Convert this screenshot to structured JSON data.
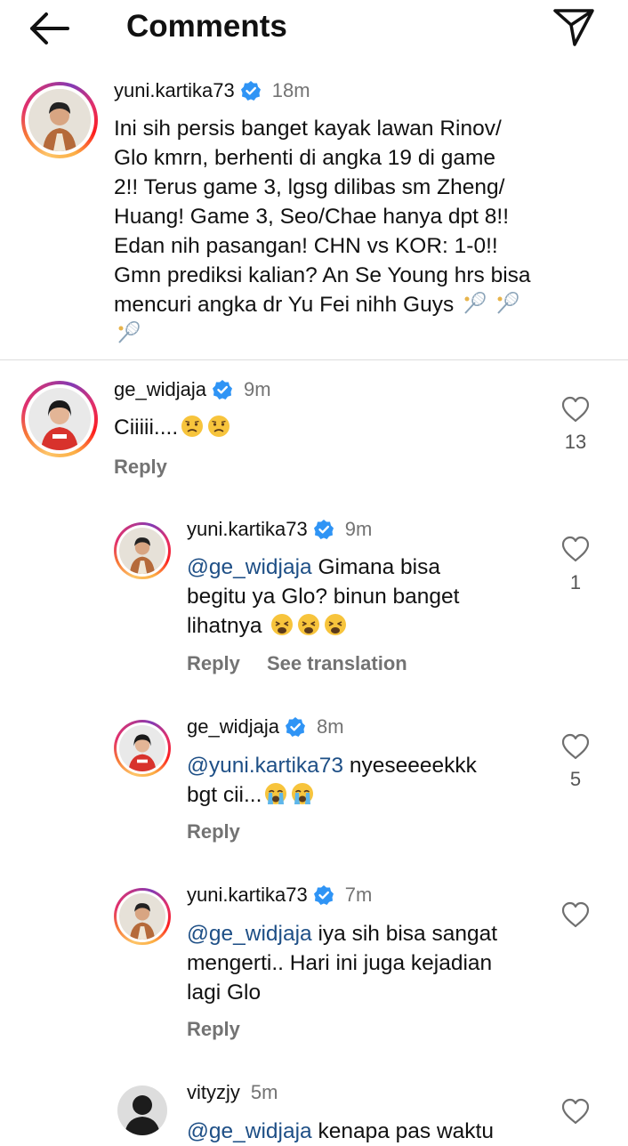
{
  "header": {
    "title": "Comments"
  },
  "caption": {
    "username": "yuni.kartika73",
    "time": "18m",
    "lines": [
      "Ini sih persis banget kayak lawan Rinov/",
      "Glo kmrn, berhenti di angka 19 di game",
      "2!! Terus game 3, lgsg dilibas sm Zheng/",
      "Huang! Game 3, Seo/Chae hanya dpt 8!!",
      "Edan nih pasangan! CHN vs KOR: 1-0!!",
      "Gmn prediksi kalian? An Se Young hrs bisa",
      "mencuri angka dr Yu Fei nihh Guys"
    ]
  },
  "comments": [
    {
      "username": "ge_widjaja",
      "time": "9m",
      "text": "Ciiiii....",
      "reply": "Reply",
      "likes": "13"
    },
    {
      "username": "yuni.kartika73",
      "time": "9m",
      "mention": "@ge_widjaja",
      "line1": " Gimana bisa",
      "line2": "begitu ya Glo? binun banget",
      "line3": "lihatnya",
      "reply": "Reply",
      "see_translation": "See translation",
      "likes": "1"
    },
    {
      "username": "ge_widjaja",
      "time": "8m",
      "mention": "@yuni.kartika73",
      "line1": " nyeseeeekkk",
      "line2": "bgt cii...",
      "reply": "Reply",
      "likes": "5"
    },
    {
      "username": "yuni.kartika73",
      "time": "7m",
      "mention": "@ge_widjaja",
      "line1": " iya sih bisa sangat",
      "line2": "mengerti.. Hari ini juga kejadian",
      "line3": "lagi Glo",
      "reply": "Reply"
    },
    {
      "username": "vityzjy",
      "time": "5m",
      "mention": "@ge_widjaja",
      "line1": " kenapa pas waktu"
    }
  ],
  "icons": {
    "back": "arrow-left-icon",
    "share": "paper-plane-icon",
    "verified": "verified-badge-icon",
    "heart": "heart-outline-icon",
    "badminton": "badminton-racket-icon",
    "emoji_sad": "sad-face-emoji",
    "emoji_weary": "weary-face-emoji",
    "emoji_crying": "crying-face-emoji"
  },
  "colors": {
    "verified": "#2f94f5",
    "mention": "#1e4f86",
    "muted": "#737373"
  }
}
